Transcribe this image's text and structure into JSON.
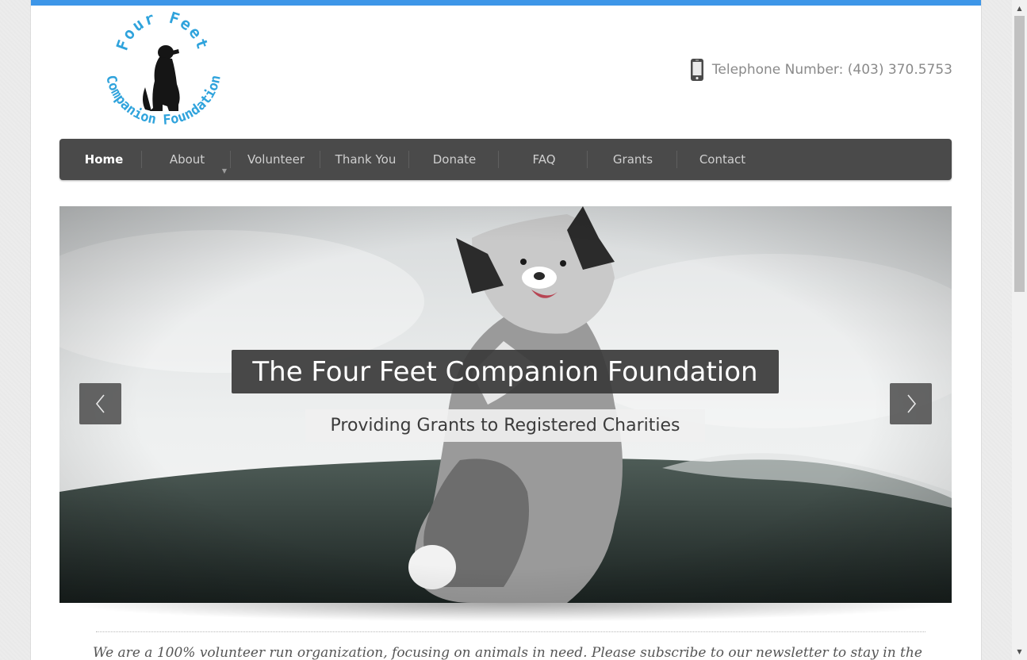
{
  "header": {
    "logo": {
      "top_text": "Four Feet",
      "bottom_text": "Companion Foundation"
    },
    "phone_icon": "mobile-phone-icon",
    "phone_text": "Telephone Number: (403) 370.5753"
  },
  "nav": {
    "items": [
      {
        "label": "Home",
        "active": true
      },
      {
        "label": "About",
        "has_dropdown": true
      },
      {
        "label": "Volunteer"
      },
      {
        "label": "Thank You"
      },
      {
        "label": "Donate"
      },
      {
        "label": "FAQ"
      },
      {
        "label": "Grants"
      },
      {
        "label": "Contact"
      }
    ],
    "dropdown_icon": "triangle-down-icon"
  },
  "slider": {
    "title": "The Four Feet Companion Foundation",
    "subtitle": "Providing Grants to Registered Charities",
    "prev_icon": "chevron-left-icon",
    "next_icon": "chevron-right-icon"
  },
  "content": {
    "intro": "We are a 100% volunteer run organization, focusing on animals in need. Please subscribe to our newsletter to stay in the"
  },
  "colors": {
    "accent": "#3d96e8",
    "nav_bg": "#4a4a4a",
    "logo_blue": "#2fa3dc"
  }
}
